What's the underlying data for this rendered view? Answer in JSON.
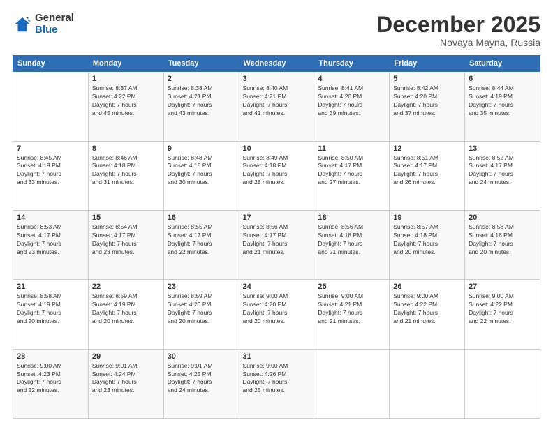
{
  "logo": {
    "general": "General",
    "blue": "Blue"
  },
  "header": {
    "month": "December 2025",
    "location": "Novaya Mayna, Russia"
  },
  "weekdays": [
    "Sunday",
    "Monday",
    "Tuesday",
    "Wednesday",
    "Thursday",
    "Friday",
    "Saturday"
  ],
  "weeks": [
    [
      {
        "day": "",
        "info": ""
      },
      {
        "day": "1",
        "info": "Sunrise: 8:37 AM\nSunset: 4:22 PM\nDaylight: 7 hours\nand 45 minutes."
      },
      {
        "day": "2",
        "info": "Sunrise: 8:38 AM\nSunset: 4:21 PM\nDaylight: 7 hours\nand 43 minutes."
      },
      {
        "day": "3",
        "info": "Sunrise: 8:40 AM\nSunset: 4:21 PM\nDaylight: 7 hours\nand 41 minutes."
      },
      {
        "day": "4",
        "info": "Sunrise: 8:41 AM\nSunset: 4:20 PM\nDaylight: 7 hours\nand 39 minutes."
      },
      {
        "day": "5",
        "info": "Sunrise: 8:42 AM\nSunset: 4:20 PM\nDaylight: 7 hours\nand 37 minutes."
      },
      {
        "day": "6",
        "info": "Sunrise: 8:44 AM\nSunset: 4:19 PM\nDaylight: 7 hours\nand 35 minutes."
      }
    ],
    [
      {
        "day": "7",
        "info": "Sunrise: 8:45 AM\nSunset: 4:19 PM\nDaylight: 7 hours\nand 33 minutes."
      },
      {
        "day": "8",
        "info": "Sunrise: 8:46 AM\nSunset: 4:18 PM\nDaylight: 7 hours\nand 31 minutes."
      },
      {
        "day": "9",
        "info": "Sunrise: 8:48 AM\nSunset: 4:18 PM\nDaylight: 7 hours\nand 30 minutes."
      },
      {
        "day": "10",
        "info": "Sunrise: 8:49 AM\nSunset: 4:18 PM\nDaylight: 7 hours\nand 28 minutes."
      },
      {
        "day": "11",
        "info": "Sunrise: 8:50 AM\nSunset: 4:17 PM\nDaylight: 7 hours\nand 27 minutes."
      },
      {
        "day": "12",
        "info": "Sunrise: 8:51 AM\nSunset: 4:17 PM\nDaylight: 7 hours\nand 26 minutes."
      },
      {
        "day": "13",
        "info": "Sunrise: 8:52 AM\nSunset: 4:17 PM\nDaylight: 7 hours\nand 24 minutes."
      }
    ],
    [
      {
        "day": "14",
        "info": "Sunrise: 8:53 AM\nSunset: 4:17 PM\nDaylight: 7 hours\nand 23 minutes."
      },
      {
        "day": "15",
        "info": "Sunrise: 8:54 AM\nSunset: 4:17 PM\nDaylight: 7 hours\nand 23 minutes."
      },
      {
        "day": "16",
        "info": "Sunrise: 8:55 AM\nSunset: 4:17 PM\nDaylight: 7 hours\nand 22 minutes."
      },
      {
        "day": "17",
        "info": "Sunrise: 8:56 AM\nSunset: 4:17 PM\nDaylight: 7 hours\nand 21 minutes."
      },
      {
        "day": "18",
        "info": "Sunrise: 8:56 AM\nSunset: 4:18 PM\nDaylight: 7 hours\nand 21 minutes."
      },
      {
        "day": "19",
        "info": "Sunrise: 8:57 AM\nSunset: 4:18 PM\nDaylight: 7 hours\nand 20 minutes."
      },
      {
        "day": "20",
        "info": "Sunrise: 8:58 AM\nSunset: 4:18 PM\nDaylight: 7 hours\nand 20 minutes."
      }
    ],
    [
      {
        "day": "21",
        "info": "Sunrise: 8:58 AM\nSunset: 4:19 PM\nDaylight: 7 hours\nand 20 minutes."
      },
      {
        "day": "22",
        "info": "Sunrise: 8:59 AM\nSunset: 4:19 PM\nDaylight: 7 hours\nand 20 minutes."
      },
      {
        "day": "23",
        "info": "Sunrise: 8:59 AM\nSunset: 4:20 PM\nDaylight: 7 hours\nand 20 minutes."
      },
      {
        "day": "24",
        "info": "Sunrise: 9:00 AM\nSunset: 4:20 PM\nDaylight: 7 hours\nand 20 minutes."
      },
      {
        "day": "25",
        "info": "Sunrise: 9:00 AM\nSunset: 4:21 PM\nDaylight: 7 hours\nand 21 minutes."
      },
      {
        "day": "26",
        "info": "Sunrise: 9:00 AM\nSunset: 4:22 PM\nDaylight: 7 hours\nand 21 minutes."
      },
      {
        "day": "27",
        "info": "Sunrise: 9:00 AM\nSunset: 4:22 PM\nDaylight: 7 hours\nand 22 minutes."
      }
    ],
    [
      {
        "day": "28",
        "info": "Sunrise: 9:00 AM\nSunset: 4:23 PM\nDaylight: 7 hours\nand 22 minutes."
      },
      {
        "day": "29",
        "info": "Sunrise: 9:01 AM\nSunset: 4:24 PM\nDaylight: 7 hours\nand 23 minutes."
      },
      {
        "day": "30",
        "info": "Sunrise: 9:01 AM\nSunset: 4:25 PM\nDaylight: 7 hours\nand 24 minutes."
      },
      {
        "day": "31",
        "info": "Sunrise: 9:00 AM\nSunset: 4:26 PM\nDaylight: 7 hours\nand 25 minutes."
      },
      {
        "day": "",
        "info": ""
      },
      {
        "day": "",
        "info": ""
      },
      {
        "day": "",
        "info": ""
      }
    ]
  ]
}
